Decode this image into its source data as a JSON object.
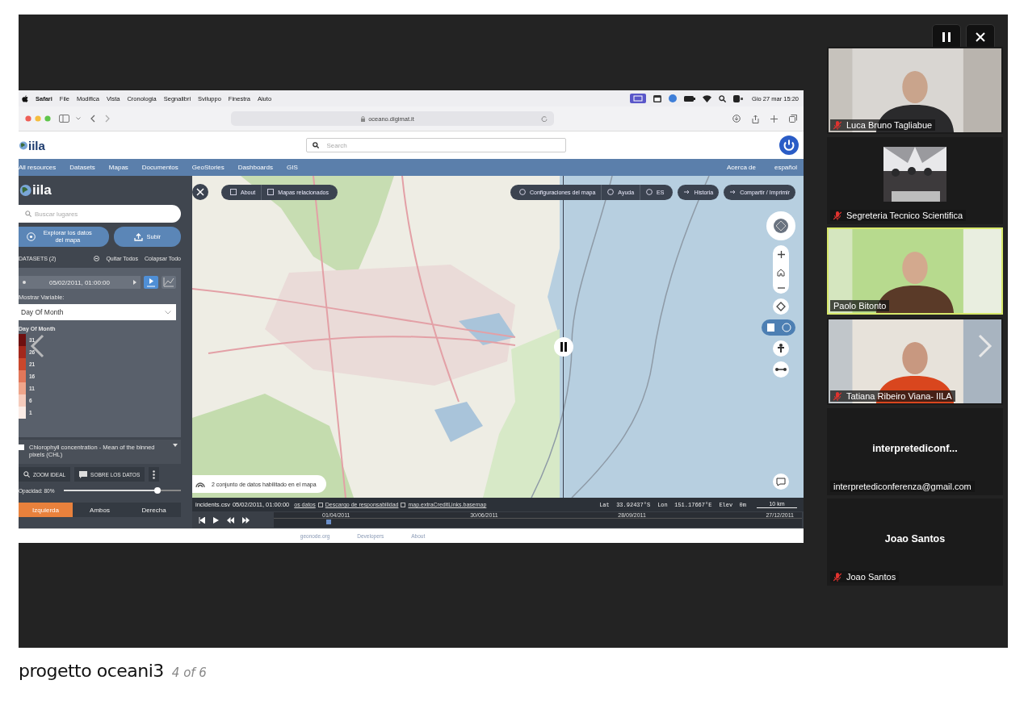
{
  "presentation": {
    "title": "progetto oceani3",
    "counter": "4 of 6"
  },
  "menu_bar": {
    "app": "Safari",
    "items": [
      "File",
      "Modifica",
      "Vista",
      "Cronologia",
      "Segnalibri",
      "Sviluppo",
      "Finestra",
      "Aiuto"
    ],
    "clock": "Gio 27 mar 15:20"
  },
  "browser": {
    "url": "oceano.digimat.it"
  },
  "site": {
    "logo": "iila",
    "search": {
      "placeholder": "Search"
    },
    "nav": [
      "All resources",
      "Datasets",
      "Mapas",
      "Documentos",
      "GeoStories",
      "Dashboards",
      "GIS"
    ],
    "nav_right": [
      "Acerca de",
      "español"
    ]
  },
  "sidebar": {
    "logo": "iila",
    "search": {
      "placeholder": "Buscar lugares"
    },
    "buttons": [
      "Explorar los datos del mapa",
      "Subir"
    ],
    "datasets_header": {
      "title": "DATASETS (2)",
      "actions": [
        "Quitar Todos",
        "Colapsar Todo"
      ]
    },
    "layer": {
      "time": "05/02/2011, 01:00:00",
      "variable_label": "Mostrar Variable:",
      "variable": "Day Of Month",
      "legend_title": "Day Of Month",
      "legend": [
        {
          "label": "31",
          "color": "#6e1010"
        },
        {
          "label": "26",
          "color": "#a3281c"
        },
        {
          "label": "21",
          "color": "#c9472c"
        },
        {
          "label": "16",
          "color": "#e2775a"
        },
        {
          "label": "11",
          "color": "#efa58b"
        },
        {
          "label": "6",
          "color": "#f6ccbd"
        },
        {
          "label": "1",
          "color": "#fbece6"
        }
      ]
    },
    "layer2": {
      "name": "Chlorophyll concentration - Mean of the binned pixels (CHL)",
      "checked": false,
      "buttons": [
        "ZOOM IDEAL",
        "SOBRE LOS DATOS"
      ],
      "opacity": {
        "label": "Opacidad: 80%",
        "level": 0.8
      }
    },
    "swipe_tabs": [
      {
        "label": "Izquierda",
        "selected": true
      },
      {
        "label": "Ambos",
        "selected": false
      },
      {
        "label": "Derecha",
        "selected": false
      }
    ]
  },
  "map": {
    "toolbar_left": [
      "About",
      "Mapas relacionados"
    ],
    "toolbar_right": [
      "Configuraciones del mapa",
      "Ayuda",
      "ES",
      "Historia",
      "Compartir / Imprimir"
    ],
    "datasets_note": "2 conjunto de datos habilitado en el mapa",
    "status": {
      "file": "incidents.csv",
      "time": "05/02/2011, 01:00:00",
      "links": [
        "os datos",
        "Descargo de responsabilidad",
        "map.extraCreditLinks.basemap"
      ],
      "lat": "Lat  33.92437°S",
      "lon": "Lon  151.17667°E",
      "elev": "Elev  0m",
      "scale": "10 km"
    },
    "timeline": {
      "dates": [
        "01/04/2011",
        "30/06/2011",
        "28/09/2011",
        "27/12/2011"
      ],
      "level": 0.1
    }
  },
  "footer_links": [
    "geonode.org",
    "Developers",
    "About"
  ],
  "participants": [
    {
      "name": "Luca Bruno Tagliabue",
      "kind": "video",
      "muted": true,
      "speaking": false
    },
    {
      "name": "Segreteria Tecnico Scientifica",
      "muted": true,
      "speaking": false
    },
    {
      "name": "Paolo Bitonto",
      "kind": "video",
      "muted": false,
      "speaking": true
    },
    {
      "name": "Tatiana Ribeiro Viana- IILA",
      "kind": "video",
      "muted": true,
      "speaking": false
    },
    {
      "name": "interpretediconferenza@gmail.com",
      "kind": "name",
      "display": "interpretediconf...",
      "muted": false,
      "speaking": false
    },
    {
      "name": "Joao Santos",
      "kind": "name",
      "display": "Joao Santos",
      "muted": true,
      "speaking": false
    }
  ]
}
